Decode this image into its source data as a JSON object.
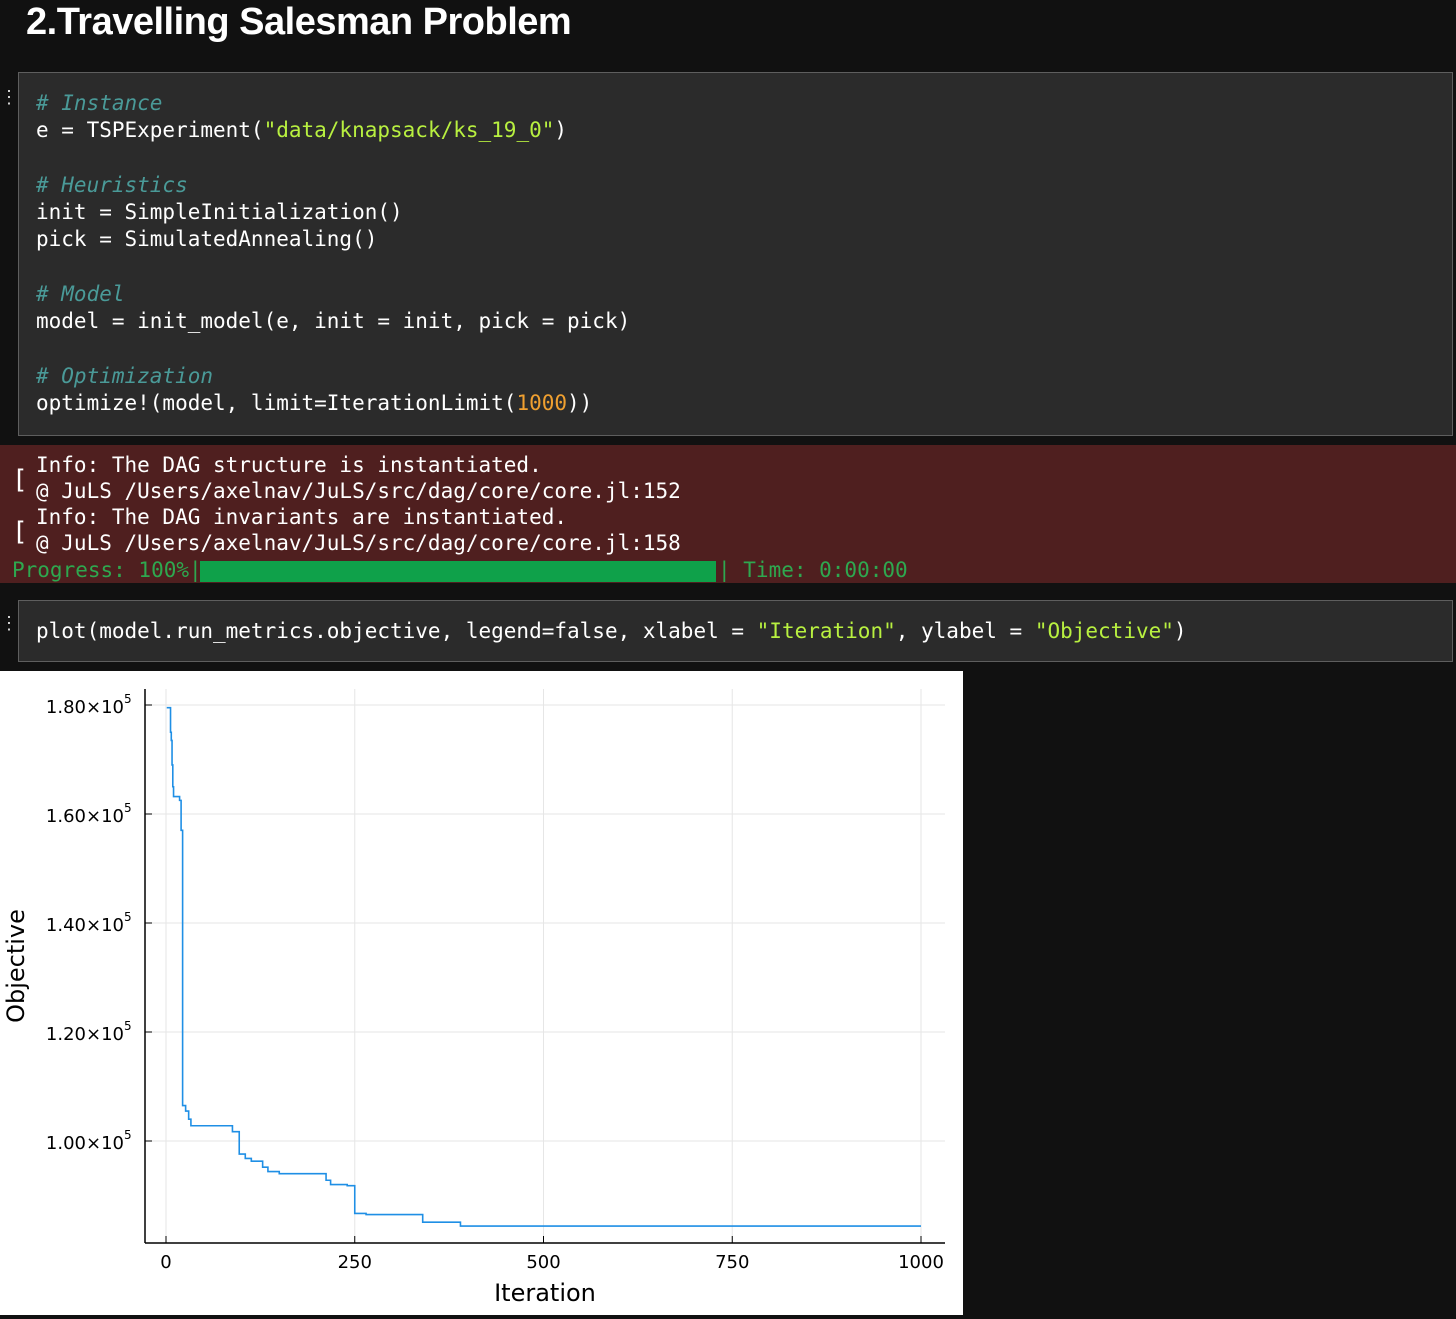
{
  "section": {
    "title": "2.Travelling Salesman Problem"
  },
  "cell1": {
    "lines": [
      [
        {
          "t": "# Instance",
          "c": "cm"
        }
      ],
      [
        {
          "t": "e = TSPExperiment(",
          "c": ""
        },
        {
          "t": "\"data/knapsack/ks_19_0\"",
          "c": "str"
        },
        {
          "t": ")",
          "c": ""
        }
      ],
      [],
      [
        {
          "t": "# Heuristics",
          "c": "cm"
        }
      ],
      [
        {
          "t": "init = SimpleInitialization()",
          "c": ""
        }
      ],
      [
        {
          "t": "pick = SimulatedAnnealing()",
          "c": ""
        }
      ],
      [],
      [
        {
          "t": "# Model",
          "c": "cm"
        }
      ],
      [
        {
          "t": "model = init_model(e, init = init, pick = pick)",
          "c": ""
        }
      ],
      [],
      [
        {
          "t": "# Optimization",
          "c": "cm"
        }
      ],
      [
        {
          "t": "optimize!(model, limit=IterationLimit(",
          "c": ""
        },
        {
          "t": "1000",
          "c": "num"
        },
        {
          "t": "))",
          "c": ""
        }
      ]
    ]
  },
  "output": {
    "info1": "Info: The DAG structure is instantiated.",
    "loc1": "@ JuLS /Users/axelnav/JuLS/src/dag/core/core.jl:152",
    "info2": "Info: The DAG invariants are instantiated.",
    "loc2": "@ JuLS /Users/axelnav/JuLS/src/dag/core/core.jl:158",
    "progress_label": "Progress: 100%|",
    "progress_fraction": 1.0,
    "time_label": "| Time: 0:00:00",
    "bracket": "["
  },
  "cell2": {
    "lines": [
      [
        {
          "t": "plot(model.run_metrics.objective, legend=false, xlabel = ",
          "c": ""
        },
        {
          "t": "\"Iteration\"",
          "c": "str"
        },
        {
          "t": ", ylabel = ",
          "c": ""
        },
        {
          "t": "\"Objective\"",
          "c": "str"
        },
        {
          "t": ")",
          "c": ""
        }
      ]
    ]
  },
  "chart_data": {
    "type": "line",
    "xlabel": "Iteration",
    "ylabel": "Objective",
    "xlim": [
      0,
      1000
    ],
    "ylim": [
      84000,
      180000
    ],
    "xticks": [
      0,
      250,
      500,
      750,
      1000
    ],
    "xtick_labels": [
      "0",
      "250",
      "500",
      "750",
      "1000"
    ],
    "yticks": [
      100000,
      120000,
      140000,
      160000,
      180000
    ],
    "ytick_labels": [
      {
        "mantissa": "1.00×10",
        "exp": "5"
      },
      {
        "mantissa": "1.20×10",
        "exp": "5"
      },
      {
        "mantissa": "1.40×10",
        "exp": "5"
      },
      {
        "mantissa": "1.60×10",
        "exp": "5"
      },
      {
        "mantissa": "1.80×10",
        "exp": "5"
      }
    ],
    "legend": false,
    "grid": true,
    "line_color": "#1f8fe5",
    "series": [
      {
        "step": true,
        "x": [
          1,
          5,
          6,
          7,
          8,
          9,
          10,
          18,
          20,
          22,
          24,
          26,
          30,
          33,
          35,
          88,
          97,
          100,
          105,
          113,
          120,
          128,
          135,
          150,
          170,
          190,
          200,
          212,
          218,
          228,
          240,
          250,
          265,
          300,
          340,
          390,
          500,
          750,
          1000
        ],
        "y": [
          179500,
          179500,
          175000,
          173500,
          169000,
          165000,
          163200,
          162500,
          157000,
          106500,
          106500,
          105500,
          104000,
          102800,
          102800,
          101700,
          97600,
          97600,
          96800,
          96300,
          96300,
          95200,
          94400,
          94000,
          94000,
          94000,
          94000,
          92800,
          92000,
          92000,
          91800,
          86700,
          86500,
          86500,
          85100,
          84400,
          84400,
          84400,
          84400
        ]
      }
    ]
  }
}
